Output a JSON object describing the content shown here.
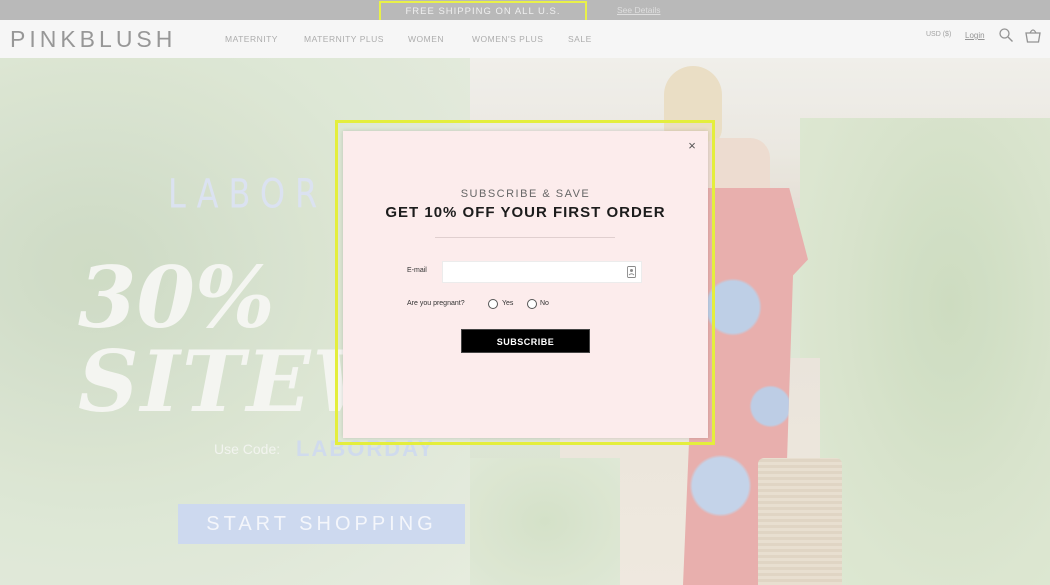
{
  "promo": {
    "text": "FREE SHIPPING ON ALL U.S. ORDERS",
    "link": "See Details"
  },
  "header": {
    "logo": "PINKBLUSH",
    "nav": [
      "MATERNITY",
      "MATERNITY PLUS",
      "WOMEN",
      "WOMEN'S PLUS",
      "SALE"
    ],
    "currency": "USD ($)",
    "login": "Login",
    "icons": [
      "search-icon",
      "shopping-bag-icon"
    ]
  },
  "hero": {
    "headline": "LABOR D",
    "big_line1": "30%",
    "big_line2": "SITEW",
    "code_label": "Use Code:",
    "code": "LABORDAY",
    "cta": "START SHOPPING"
  },
  "modal": {
    "close": "×",
    "eyebrow": "SUBSCRIBE & SAVE",
    "title": "GET 10% OFF YOUR FIRST ORDER",
    "email_label": "E-mail",
    "email_value": "",
    "pregnant_label": "Are you pregnant?",
    "options": [
      "Yes",
      "No"
    ],
    "subscribe": "SUBSCRIBE"
  },
  "colors": {
    "highlight": "#e4ee3c",
    "modal_bg": "#fcecec",
    "promo_bg": "#b4b4b4",
    "cta_bg": "#c9d6ee"
  }
}
